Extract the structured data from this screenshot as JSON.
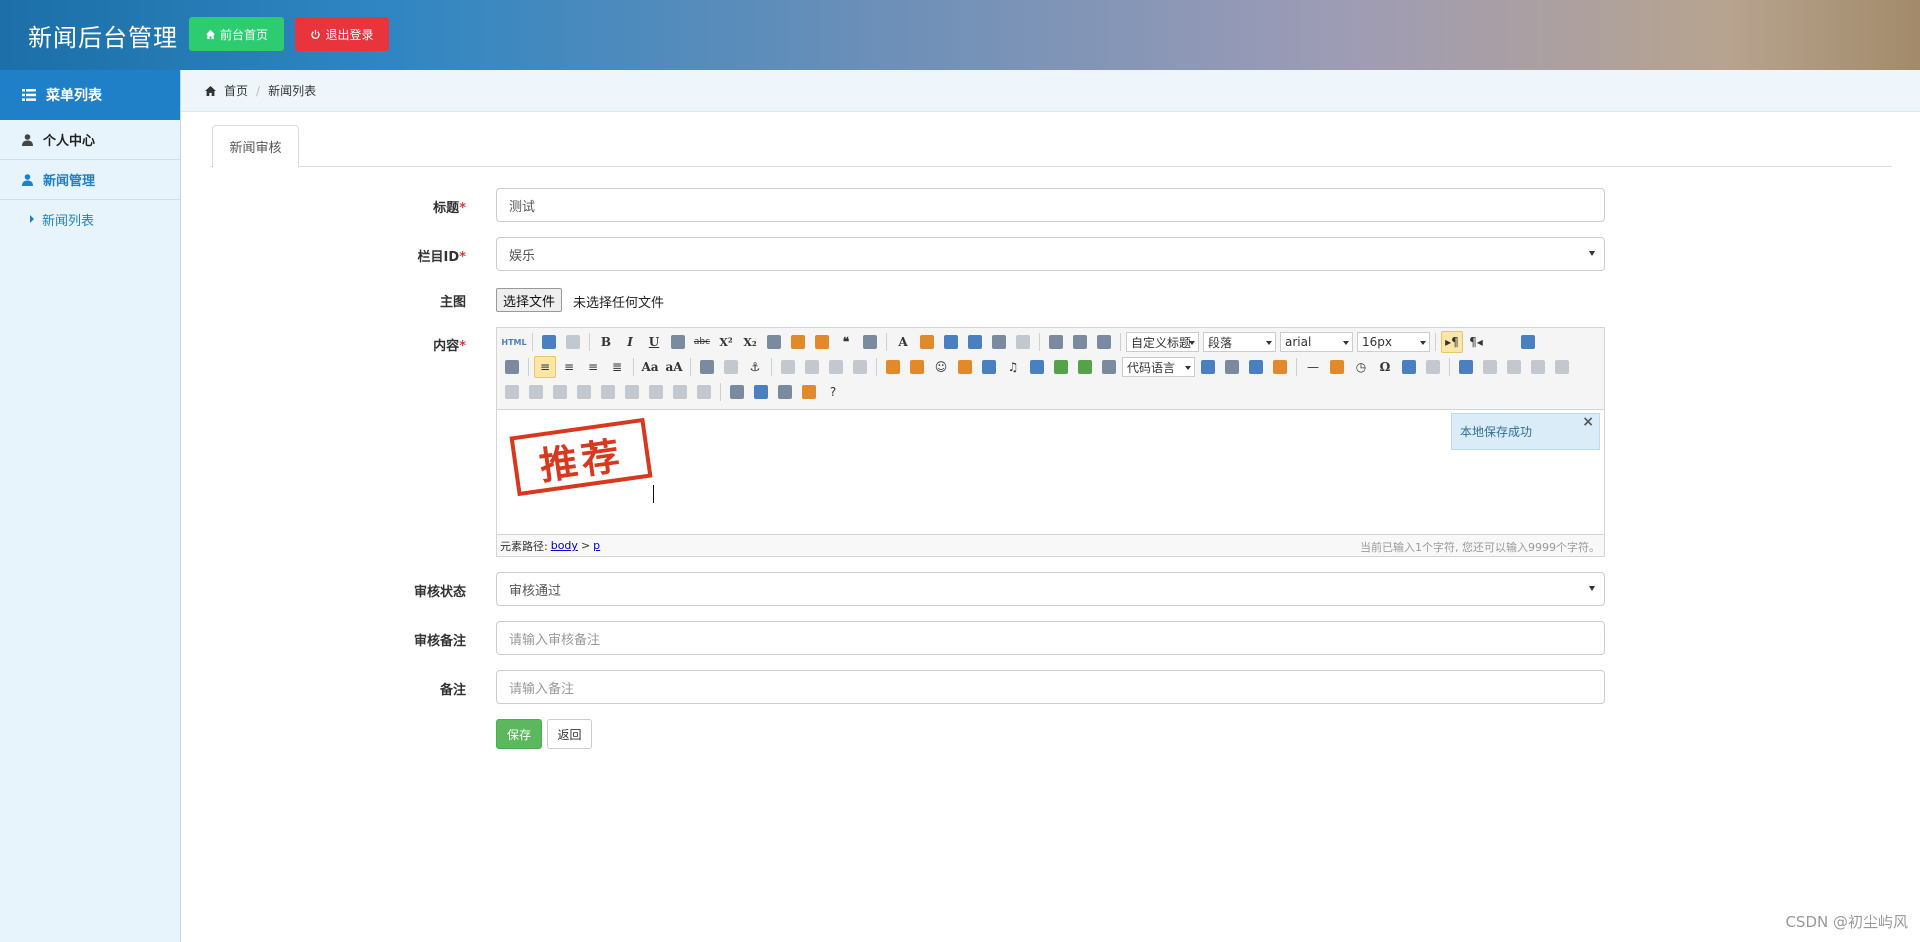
{
  "header": {
    "title": "新闻后台管理",
    "home_button": "前台首页",
    "logout_button": "退出登录"
  },
  "sidebar": {
    "heading": "菜单列表",
    "items": [
      {
        "label": "个人中心"
      },
      {
        "label": "新闻管理"
      }
    ],
    "sub_items": [
      {
        "label": "新闻列表"
      }
    ]
  },
  "breadcrumb": {
    "home": "首页",
    "current": "新闻列表"
  },
  "tabs": [
    {
      "label": "新闻审核"
    }
  ],
  "form": {
    "title": {
      "label": "标题",
      "required": "*",
      "value": "测试"
    },
    "column": {
      "label": "栏目ID",
      "required": "*",
      "value": "娱乐"
    },
    "image": {
      "label": "主图",
      "button": "选择文件",
      "status": "未选择任何文件"
    },
    "content": {
      "label": "内容",
      "required": "*"
    },
    "review_status": {
      "label": "审核状态",
      "value": "审核通过"
    },
    "review_note": {
      "label": "审核备注",
      "placeholder": "请输入审核备注"
    },
    "note": {
      "label": "备注",
      "placeholder": "请输入备注"
    }
  },
  "editor": {
    "toolbar": {
      "html_label": "HTML",
      "custom_heading": "自定义标题",
      "paragraph": "段落",
      "font_family": "arial",
      "font_size": "16px",
      "code_language": "代码语言"
    },
    "stamp_text": "推荐",
    "toast": "本地保存成功",
    "path_label": "元素路径:",
    "path_items": [
      "body",
      "p"
    ],
    "path_separator": ">",
    "word_count": "当前已输入1个字符, 您还可以输入9999个字符。"
  },
  "actions": {
    "save": "保存",
    "back": "返回"
  },
  "watermark": "CSDN @初尘屿风"
}
